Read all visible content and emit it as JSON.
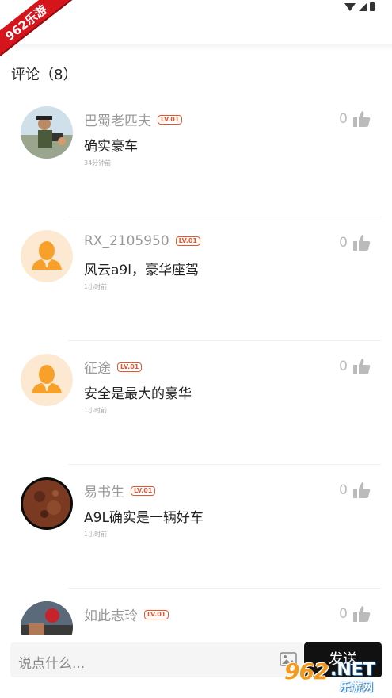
{
  "ribbon_text": "962乐游",
  "comments_header": "评论（8）",
  "comments": [
    {
      "username": "巴蜀老匹夫",
      "level": "LV.01",
      "text": "确实豪车",
      "time": "34分钟前",
      "likes": "0",
      "avatar": "photo-person"
    },
    {
      "username": "RX_2105950",
      "level": "LV.01",
      "text": "风云a9l，豪华座驾",
      "time": "1小时前",
      "likes": "0",
      "avatar": "default-person"
    },
    {
      "username": "征途",
      "level": "LV.01",
      "text": "安全是最大的豪华",
      "time": "1小时前",
      "likes": "0",
      "avatar": "default-person"
    },
    {
      "username": "易书生",
      "level": "LV.01",
      "text": "A9L确实是一辆好车",
      "time": "1小时前",
      "likes": "0",
      "avatar": "moon-photo"
    },
    {
      "username": "如此志玲",
      "level": "LV.01",
      "text": "",
      "time": "",
      "likes": "0",
      "avatar": "photo-flowers"
    }
  ],
  "input": {
    "placeholder": "说点什么..."
  },
  "send_label": "发送",
  "watermark": {
    "number": "962",
    "net": ".NET",
    "cn": "乐游网"
  },
  "colors": {
    "accent": "#e4572e",
    "avatar_bg": "#fde9d2",
    "avatar_fg": "#f7a12a",
    "send_bg": "#111111"
  }
}
